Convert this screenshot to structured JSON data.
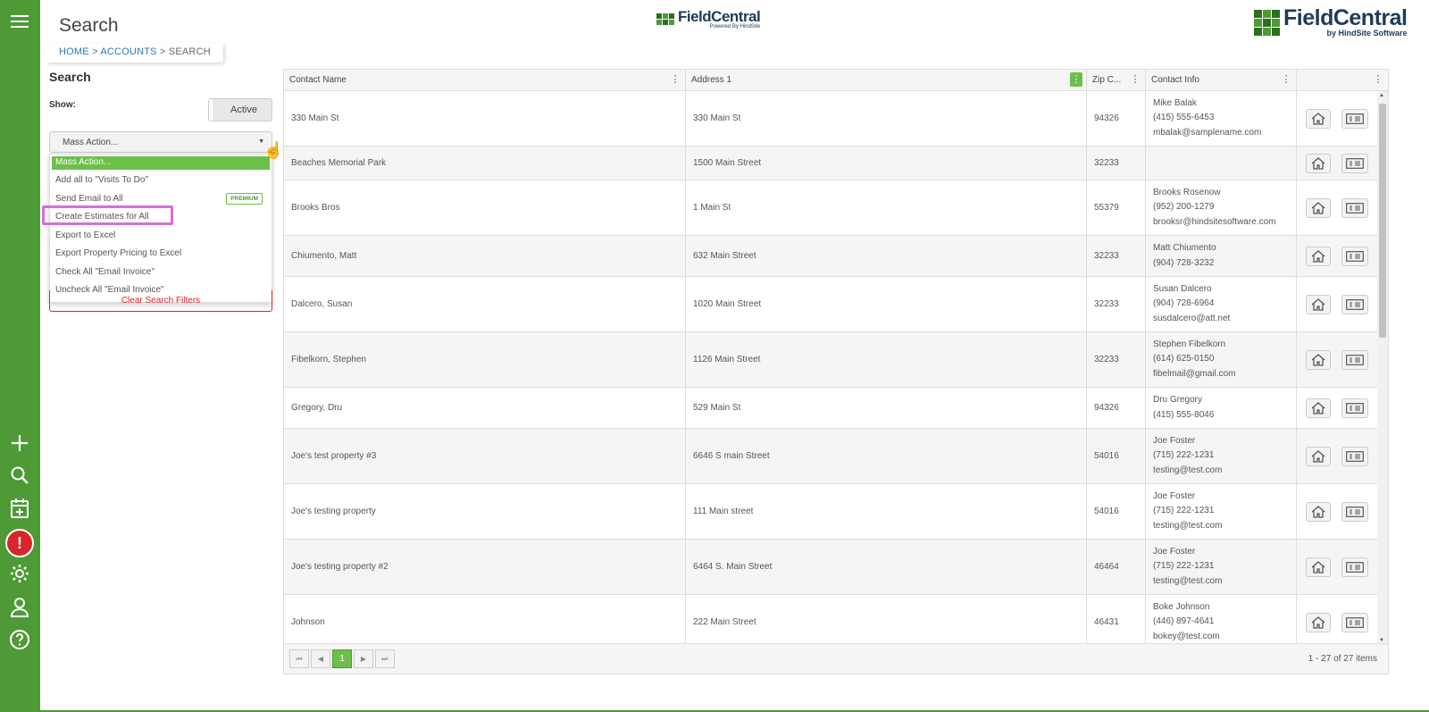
{
  "header": {
    "title": "Search",
    "breadcrumb": {
      "home": "HOME",
      "sep1": " > ",
      "accounts": "ACCOUNTS",
      "sep2": " > ",
      "current": "SEARCH"
    },
    "center_logo": {
      "brand": "FieldCentral",
      "sub": "Powered By HindSite"
    },
    "right_logo": {
      "brand": "FieldCentral",
      "sub": "by HindSite Software"
    }
  },
  "sidebar": {
    "icons": [
      "menu-icon",
      "add-icon",
      "search-icon",
      "calendar-add-icon",
      "alert-icon",
      "settings-icon",
      "user-icon",
      "help-icon"
    ],
    "alert_glyph": "!"
  },
  "left_panel": {
    "title": "Search",
    "show_label": "Show:",
    "toggle_value": "Active",
    "mass_action": "Mass Action...",
    "dropdown_items": [
      "Mass Action...",
      "Add all to \"Visits To Do\"",
      "Send Email to All",
      "Create Estimates for All",
      "Export to Excel",
      "Export Property Pricing to Excel",
      "Check All \"Email Invoice\"",
      "Uncheck All \"Email Invoice\""
    ],
    "premium_badge": "PREMIUM",
    "clear_filters": "Clear Search Filters"
  },
  "grid": {
    "columns": [
      "Contact Name",
      "Address 1",
      "Zip C...",
      "Contact Info",
      ""
    ],
    "rows": [
      {
        "name": "330 Main St",
        "address": "330 Main St",
        "zip": "94326",
        "contact": [
          "Mike Balak",
          "(415) 555-6453",
          "mbalak@samplename.com"
        ]
      },
      {
        "name": "Beaches Memorial Park",
        "address": "1500 Main Street",
        "zip": "32233",
        "contact": []
      },
      {
        "name": "Brooks Bros",
        "address": "1 Main St",
        "zip": "55379",
        "contact": [
          "Brooks Rosenow",
          "(952) 200-1279",
          "brooksr@hindsitesoftware.com"
        ]
      },
      {
        "name": "Chiumento, Matt",
        "address": "632 Main Street",
        "zip": "32233",
        "contact": [
          "Matt Chiumento",
          "(904) 728-3232"
        ]
      },
      {
        "name": "Dalcero, Susan",
        "address": "1020 Main Street",
        "zip": "32233",
        "contact": [
          "Susan Dalcero",
          "(904) 728-6964",
          "susdalcero@att.net"
        ]
      },
      {
        "name": "Fibelkorn, Stephen",
        "address": "1126 Main Street",
        "zip": "32233",
        "contact": [
          "Stephen Fibelkorn",
          "(614) 625-0150",
          "fibelmail@gmail.com"
        ]
      },
      {
        "name": "Gregory, Dru",
        "address": "529 Main St",
        "zip": "94326",
        "contact": [
          "Dru Gregory",
          "(415) 555-8046"
        ]
      },
      {
        "name": "Joe's test property #3",
        "address": "6646 S main Street",
        "zip": "54016",
        "contact": [
          "Joe Foster",
          "(715) 222-1231",
          "testing@test.com"
        ]
      },
      {
        "name": "Joe's testing property",
        "address": "111 Main street",
        "zip": "54016",
        "contact": [
          "Joe Foster",
          "(715) 222-1231",
          "testing@test.com"
        ]
      },
      {
        "name": "Joe's testing property #2",
        "address": "6464 S. Main Street",
        "zip": "46464",
        "contact": [
          "Joe Foster",
          "(715) 222-1231",
          "testing@test.com"
        ]
      },
      {
        "name": "Johnson",
        "address": "222 Main Street",
        "zip": "46431",
        "contact": [
          "Boke Johnson",
          "(446) 897-4641",
          "bokey@test.com"
        ]
      }
    ],
    "pager": {
      "first": "⏮",
      "prev": "◀",
      "current_page": "1",
      "next": "▶",
      "last": "⏭",
      "info": "1 - 27 of 27 items"
    }
  },
  "colors": {
    "brand_green": "#4e9a37",
    "accent_green": "#6cc04a",
    "alert_red": "#d7262b",
    "highlight": "#d66fd6",
    "link_blue": "#2a7ab5"
  }
}
